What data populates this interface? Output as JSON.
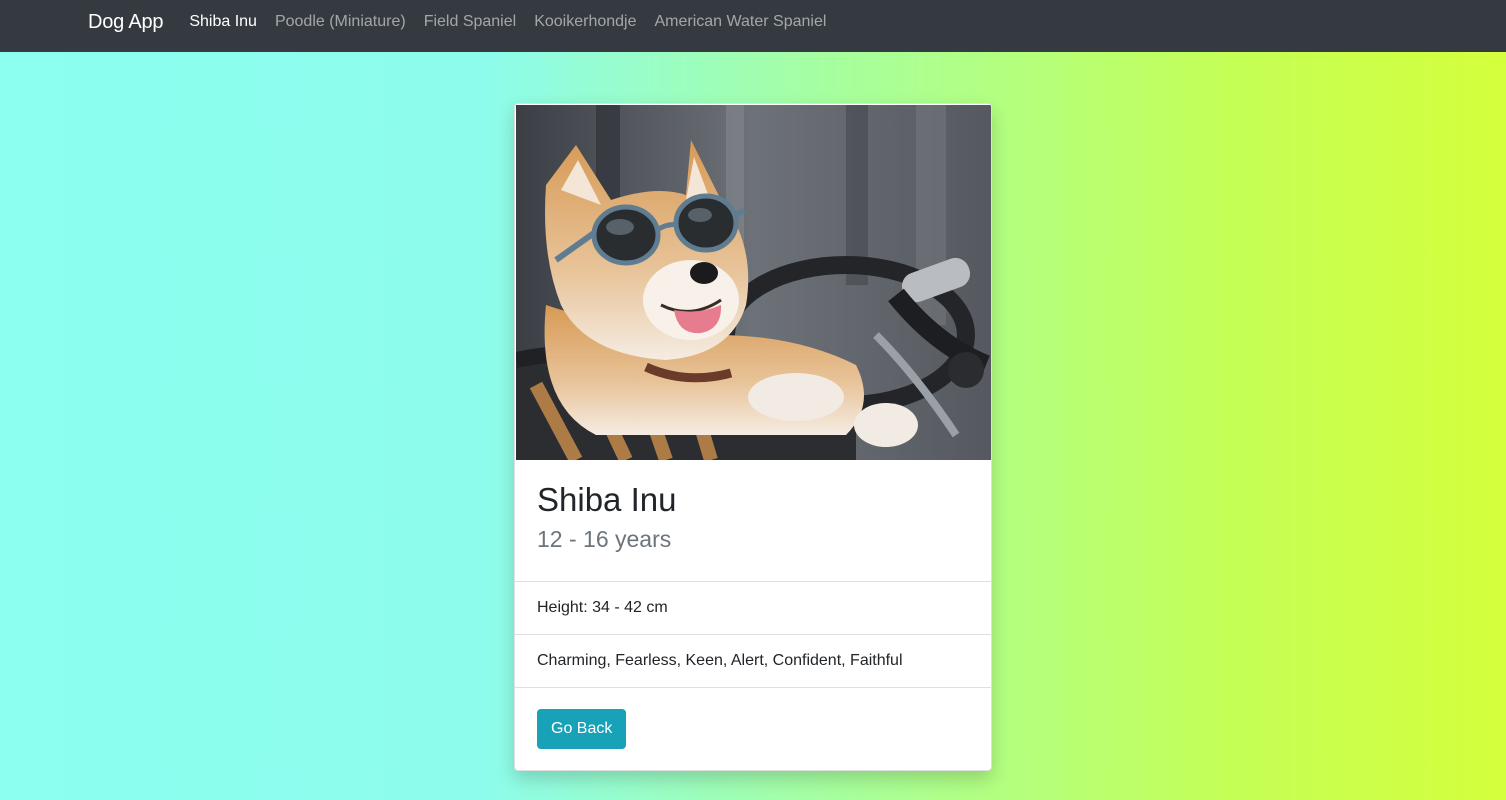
{
  "navbar": {
    "brand": "Dog App",
    "links": [
      {
        "label": "Shiba Inu",
        "active": true
      },
      {
        "label": "Poodle (Miniature)",
        "active": false
      },
      {
        "label": "Field Spaniel",
        "active": false
      },
      {
        "label": "Kooikerhondje",
        "active": false
      },
      {
        "label": "American Water Spaniel",
        "active": false
      }
    ]
  },
  "card": {
    "title": "Shiba Inu",
    "lifespan": "12 - 16 years",
    "height": "Height: 34 - 42 cm",
    "temperament": "Charming, Fearless, Keen, Alert, Confident, Faithful",
    "button_label": "Go Back"
  },
  "colors": {
    "navbar_bg": "#343a40",
    "button_bg": "#17a2b8",
    "gradient_start": "#8cfff0",
    "gradient_end": "#d4ff3c"
  }
}
